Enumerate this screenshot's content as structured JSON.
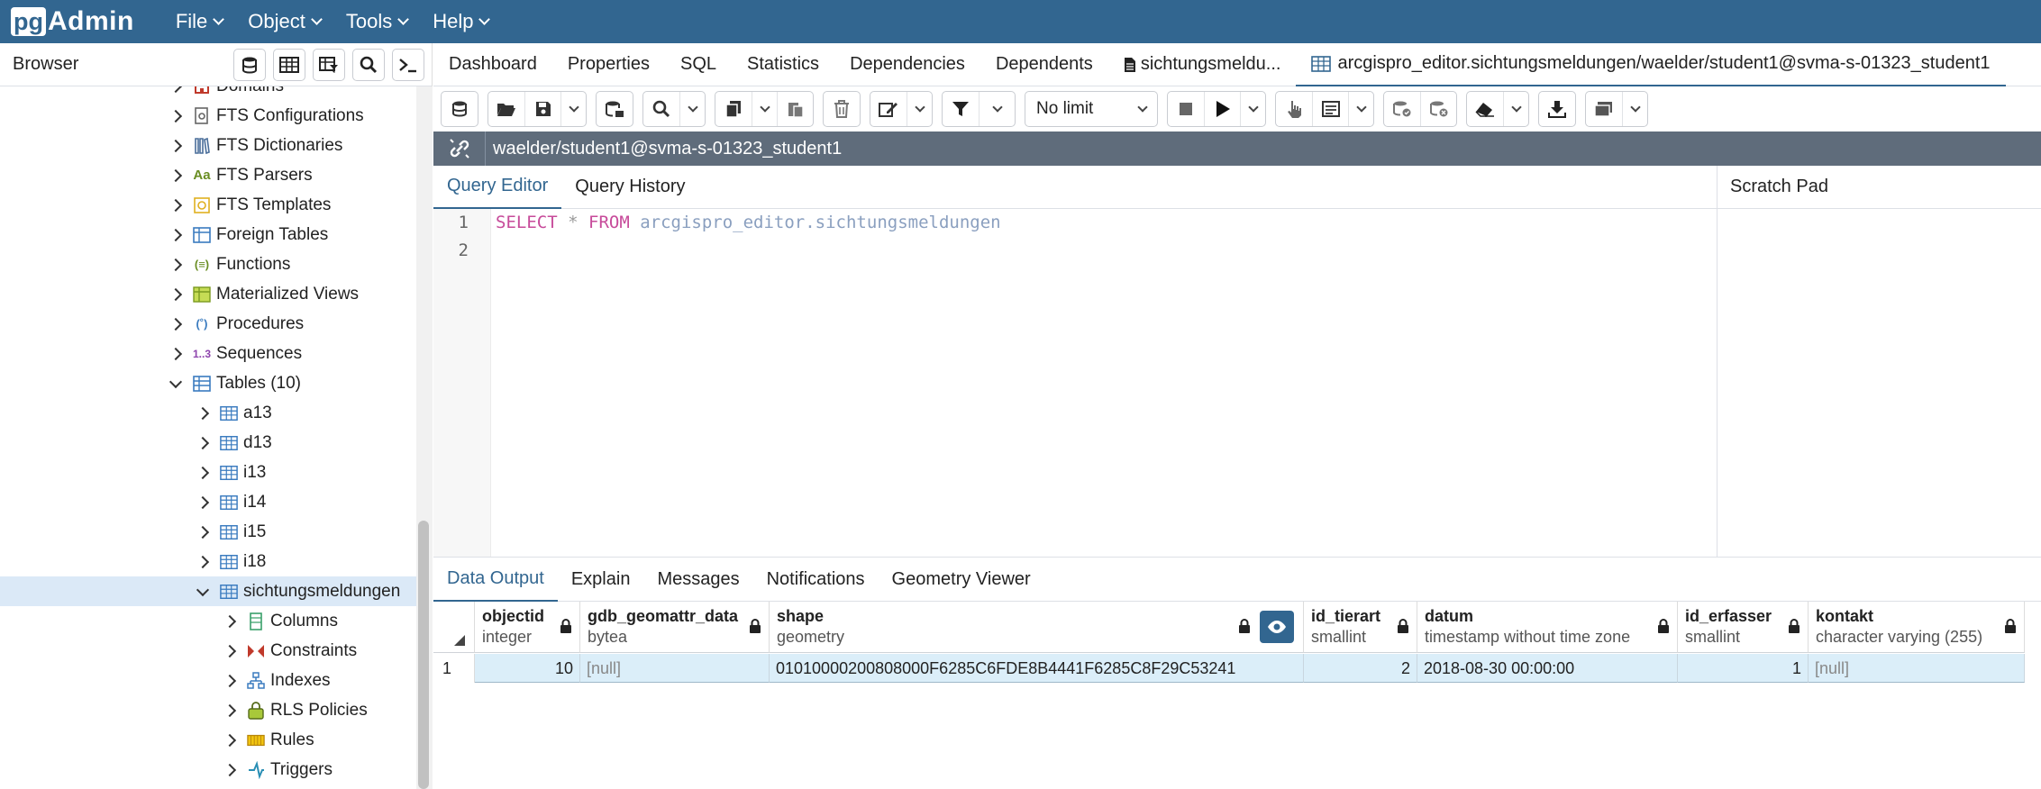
{
  "app": {
    "logo_pg": "pg",
    "logo_admin": "Admin"
  },
  "menu": {
    "items": [
      {
        "label": "File"
      },
      {
        "label": "Object"
      },
      {
        "label": "Tools"
      },
      {
        "label": "Help"
      }
    ]
  },
  "browser": {
    "title": "Browser"
  },
  "tree": {
    "items": [
      {
        "label": "Domains",
        "icon": "domains-icon"
      },
      {
        "label": "FTS Configurations",
        "icon": "fts-config-icon"
      },
      {
        "label": "FTS Dictionaries",
        "icon": "fts-dict-icon"
      },
      {
        "label": "FTS Parsers",
        "icon": "fts-parser-icon",
        "glyph": "Aa"
      },
      {
        "label": "FTS Templates",
        "icon": "fts-template-icon"
      },
      {
        "label": "Foreign Tables",
        "icon": "foreign-table-icon"
      },
      {
        "label": "Functions",
        "icon": "function-icon"
      },
      {
        "label": "Materialized Views",
        "icon": "matview-icon"
      },
      {
        "label": "Procedures",
        "icon": "procedure-icon"
      },
      {
        "label": "Sequences",
        "icon": "sequence-icon",
        "glyph": "1..3"
      },
      {
        "label": "Tables (10)",
        "icon": "tables-icon"
      },
      {
        "label": "a13",
        "icon": "table-icon"
      },
      {
        "label": "d13",
        "icon": "table-icon"
      },
      {
        "label": "i13",
        "icon": "table-icon"
      },
      {
        "label": "i14",
        "icon": "table-icon"
      },
      {
        "label": "i15",
        "icon": "table-icon"
      },
      {
        "label": "i18",
        "icon": "table-icon"
      },
      {
        "label": "sichtungsmeldungen",
        "icon": "table-icon"
      },
      {
        "label": "Columns",
        "icon": "columns-icon"
      },
      {
        "label": "Constraints",
        "icon": "constraints-icon"
      },
      {
        "label": "Indexes",
        "icon": "indexes-icon"
      },
      {
        "label": "RLS Policies",
        "icon": "rls-icon"
      },
      {
        "label": "Rules",
        "icon": "rules-icon"
      },
      {
        "label": "Triggers",
        "icon": "triggers-icon"
      }
    ]
  },
  "tabs": {
    "items": [
      {
        "label": "Dashboard"
      },
      {
        "label": "Properties"
      },
      {
        "label": "SQL"
      },
      {
        "label": "Statistics"
      },
      {
        "label": "Dependencies"
      },
      {
        "label": "Dependents"
      },
      {
        "label": "sichtungsmeldu..."
      },
      {
        "label": "arcgispro_editor.sichtungsmeldungen/waelder/student1@svma-s-01323_student1"
      }
    ]
  },
  "toolbar": {
    "limit": "No limit"
  },
  "connection": {
    "label": "waelder/student1@svma-s-01323_student1"
  },
  "query_tabs": {
    "editor": "Query Editor",
    "history": "Query History",
    "scratch": "Scratch Pad"
  },
  "editor": {
    "line_numbers": [
      "1",
      "2"
    ],
    "line1": {
      "kw1": "SELECT",
      "op": "*",
      "kw2": "FROM",
      "ident": "arcgispro_editor.sichtungsmeldungen"
    }
  },
  "output_tabs": {
    "items": [
      {
        "label": "Data Output"
      },
      {
        "label": "Explain"
      },
      {
        "label": "Messages"
      },
      {
        "label": "Notifications"
      },
      {
        "label": "Geometry Viewer"
      }
    ]
  },
  "grid": {
    "columns": [
      {
        "name": "objectid",
        "type": "integer"
      },
      {
        "name": "gdb_geomattr_data",
        "type": "bytea"
      },
      {
        "name": "shape",
        "type": "geometry"
      },
      {
        "name": "id_tierart",
        "type": "smallint"
      },
      {
        "name": "datum",
        "type": "timestamp without time zone"
      },
      {
        "name": "id_erfasser",
        "type": "smallint"
      },
      {
        "name": "kontakt",
        "type": "character varying (255)"
      }
    ],
    "rows": [
      {
        "num": "1",
        "cells": [
          "10",
          "[null]",
          "01010000200808000F6285C6FDE8B4441F6285C8F29C53241",
          "2",
          "2018-08-30 00:00:00",
          "1",
          "[null]"
        ]
      }
    ]
  },
  "colors": {
    "brand": "#326690",
    "conn_bar": "#5f6c7b",
    "selection": "#dbeef9",
    "keyword": "#c74b9a"
  }
}
